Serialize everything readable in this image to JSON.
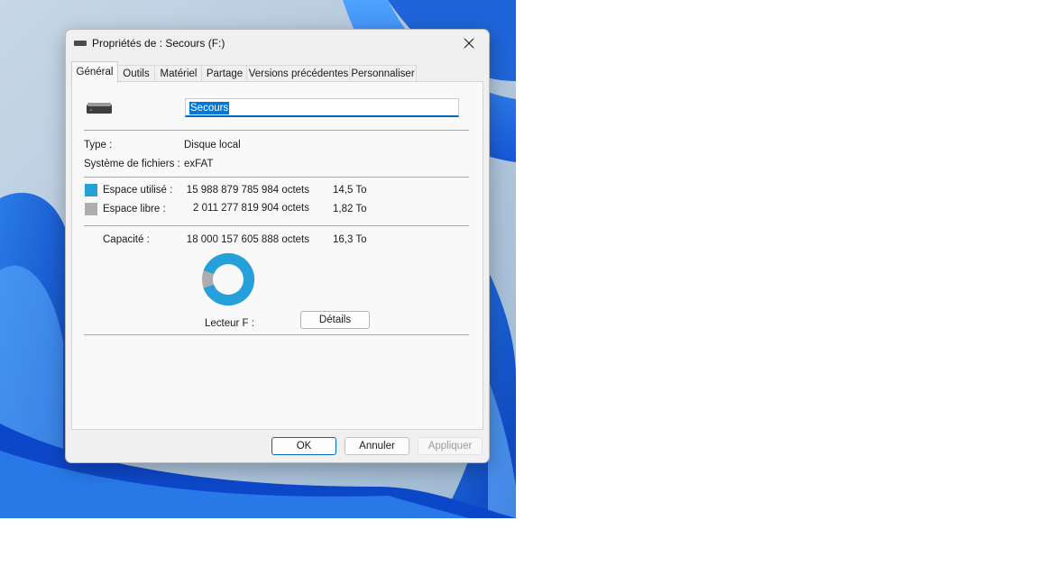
{
  "window": {
    "title": "Propriétés de : Secours (F:)"
  },
  "tabs": [
    {
      "label": "Général",
      "active": true
    },
    {
      "label": "Outils"
    },
    {
      "label": "Matériel"
    },
    {
      "label": "Partage"
    },
    {
      "label": "Versions précédentes"
    },
    {
      "label": "Personnaliser"
    }
  ],
  "general": {
    "drive_name": "Secours",
    "type_label": "Type :",
    "type_value": "Disque local",
    "fs_label": "Système de fichiers :",
    "fs_value": "exFAT",
    "used_label": "Espace utilisé :",
    "used_bytes": "15 988 879 785 984 octets",
    "used_size": "14,5 To",
    "free_label": "Espace libre :",
    "free_bytes": "2 011 277 819 904 octets",
    "free_size": "1,82 To",
    "capacity_label": "Capacité :",
    "capacity_bytes": "18 000 157 605 888 octets",
    "capacity_size": "16,3 To",
    "drive_letter_label": "Lecteur F :",
    "details_button": "Détails",
    "used_fraction": 0.8883
  },
  "colors": {
    "used": "#26a0da",
    "free": "#adadad",
    "accent": "#0067c0"
  },
  "buttons": {
    "ok": "OK",
    "cancel": "Annuler",
    "apply": "Appliquer"
  }
}
